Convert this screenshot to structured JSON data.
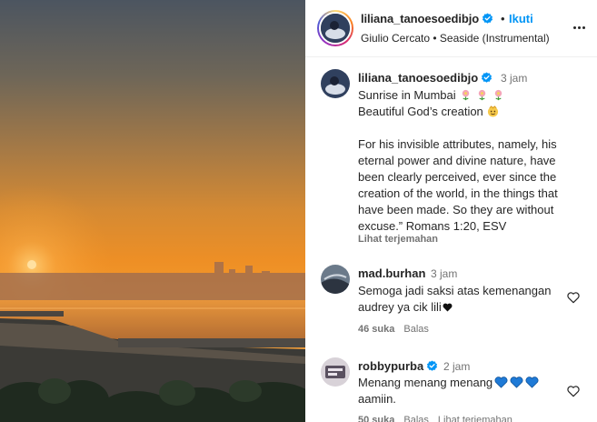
{
  "post": {
    "author": "liliana_tanoesoedibjo",
    "follow_separator": "•",
    "follow_label": "Ikuti",
    "audio": "Giulio Cercato • Seaside (Instrumental)",
    "more_icon": "more-horizontal-icon"
  },
  "caption": {
    "author": "liliana_tanoesoedibjo",
    "time": "3 jam",
    "line1": "Sunrise in Mumbai",
    "line1_emoji": "flower-emoji",
    "line2": "Beautiful God’s creation",
    "line2_emoji": "smiling-face-emoji",
    "body": "For his invisible attributes, namely, his eternal power and divine nature, have been clearly perceived, ever since the creation of the world, in the things that have been made. So they are without excuse.” Romans 1:20, ESV",
    "translate": "Lihat terjemahan"
  },
  "comments": [
    {
      "user": "mad.burhan",
      "time": "3 jam",
      "text": "Semoga jadi saksi atas kemenangan audrey ya cik lili",
      "likes": "46 suka",
      "reply": "Balas"
    },
    {
      "user": "robbypurba",
      "time": "2 jam",
      "text": "Menang menang menang",
      "text2": "aamiin.",
      "likes": "50 suka",
      "reply": "Balas",
      "translate": "Lihat terjemahan"
    }
  ],
  "colors": {
    "link_blue": "#0095f6",
    "verified_blue": "#0095f6",
    "muted": "#737373",
    "text": "#262626"
  }
}
